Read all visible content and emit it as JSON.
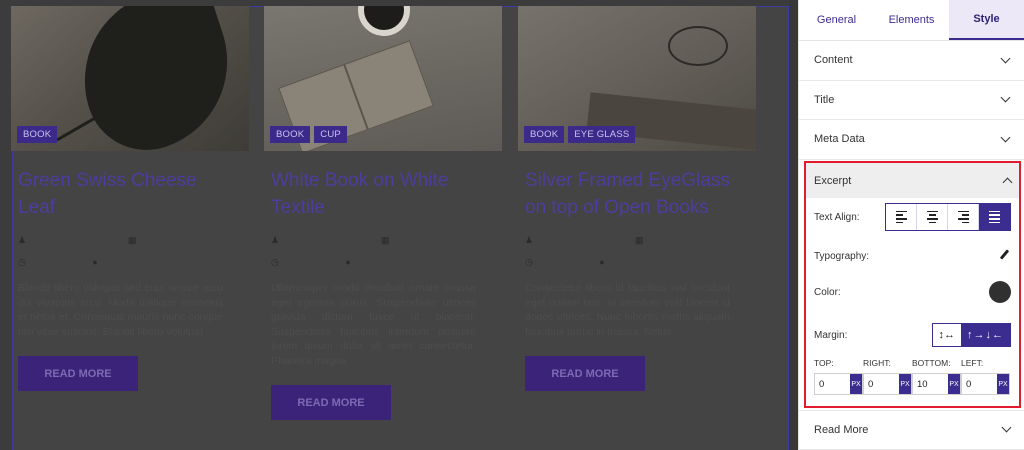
{
  "cards": [
    {
      "tags": [
        "BOOK"
      ],
      "title": "Green Swiss Cheese Leaf",
      "author": "CHARLESCORMIER",
      "date": "MAR 5, 2021",
      "read_time": "1 MIN READ",
      "comments": "0",
      "excerpt": "Blandit libero volutpat sed cras ornare arcu dui vivamus arcu. Morbi tristique senectus et netus et. Consequat mauris nunc congue nisi vitae suscipit. Blandit libero volutpat",
      "button": "READ MORE"
    },
    {
      "tags": [
        "BOOK",
        "CUP"
      ],
      "title": "White Book on White Textile",
      "author": "CHARLESCORMIER",
      "date": "MAR 5, 2021",
      "read_time": "1 MIN READ",
      "comments": "0",
      "excerpt": "Ullamcorper morbi tincidunt ornare massa eget egestas purus. Suspendisse ultrices gravida dictum fusce ut placerat. Suspendisse faucibus interdum posuere lorem ipsum dolor sit amet consectetur. Pharetra magna",
      "button": "READ MORE"
    },
    {
      "tags": [
        "BOOK",
        "EYE GLASS"
      ],
      "title": "Silver Framed EyeGlass on top of Open Books",
      "author": "CHARLESCORMIER",
      "date": "MAR 5, 2021",
      "read_time": "1 MIN READ",
      "comments": "0",
      "excerpt": "Consectetur libero id faucibus nisl tincidunt eget nullam non. Id interdum velit laoreet id donec ultrices. Nunc lobortis mattis aliquam faucibus purus in massa. Netus",
      "button": "READ MORE"
    }
  ],
  "panel": {
    "tabs": [
      "General",
      "Elements",
      "Style"
    ],
    "active_tab": "Style",
    "sections": [
      "Content",
      "Title",
      "Meta Data"
    ],
    "excerpt": {
      "title": "Excerpt",
      "text_align_label": "Text Align:",
      "align_options": [
        "left",
        "center",
        "right",
        "justify"
      ],
      "align_selected": "justify",
      "typography_label": "Typography:",
      "color_label": "Color:",
      "color_value": "#303030",
      "margin_label": "Margin:",
      "margin_mode_icons": [
        "↕↔",
        "↑→↓←"
      ],
      "margin_mode_selected": "↑→↓←",
      "side_labels": [
        "TOP:",
        "RIGHT:",
        "BOTTOM:",
        "LEFT:"
      ],
      "margin_values": [
        "0",
        "0",
        "10",
        "0"
      ],
      "unit": "PX"
    },
    "read_more": "Read More"
  },
  "colors": {
    "accent": "#3b2d8f",
    "highlight_border": "#e21c2e",
    "card_title": "#4e3c9e"
  }
}
